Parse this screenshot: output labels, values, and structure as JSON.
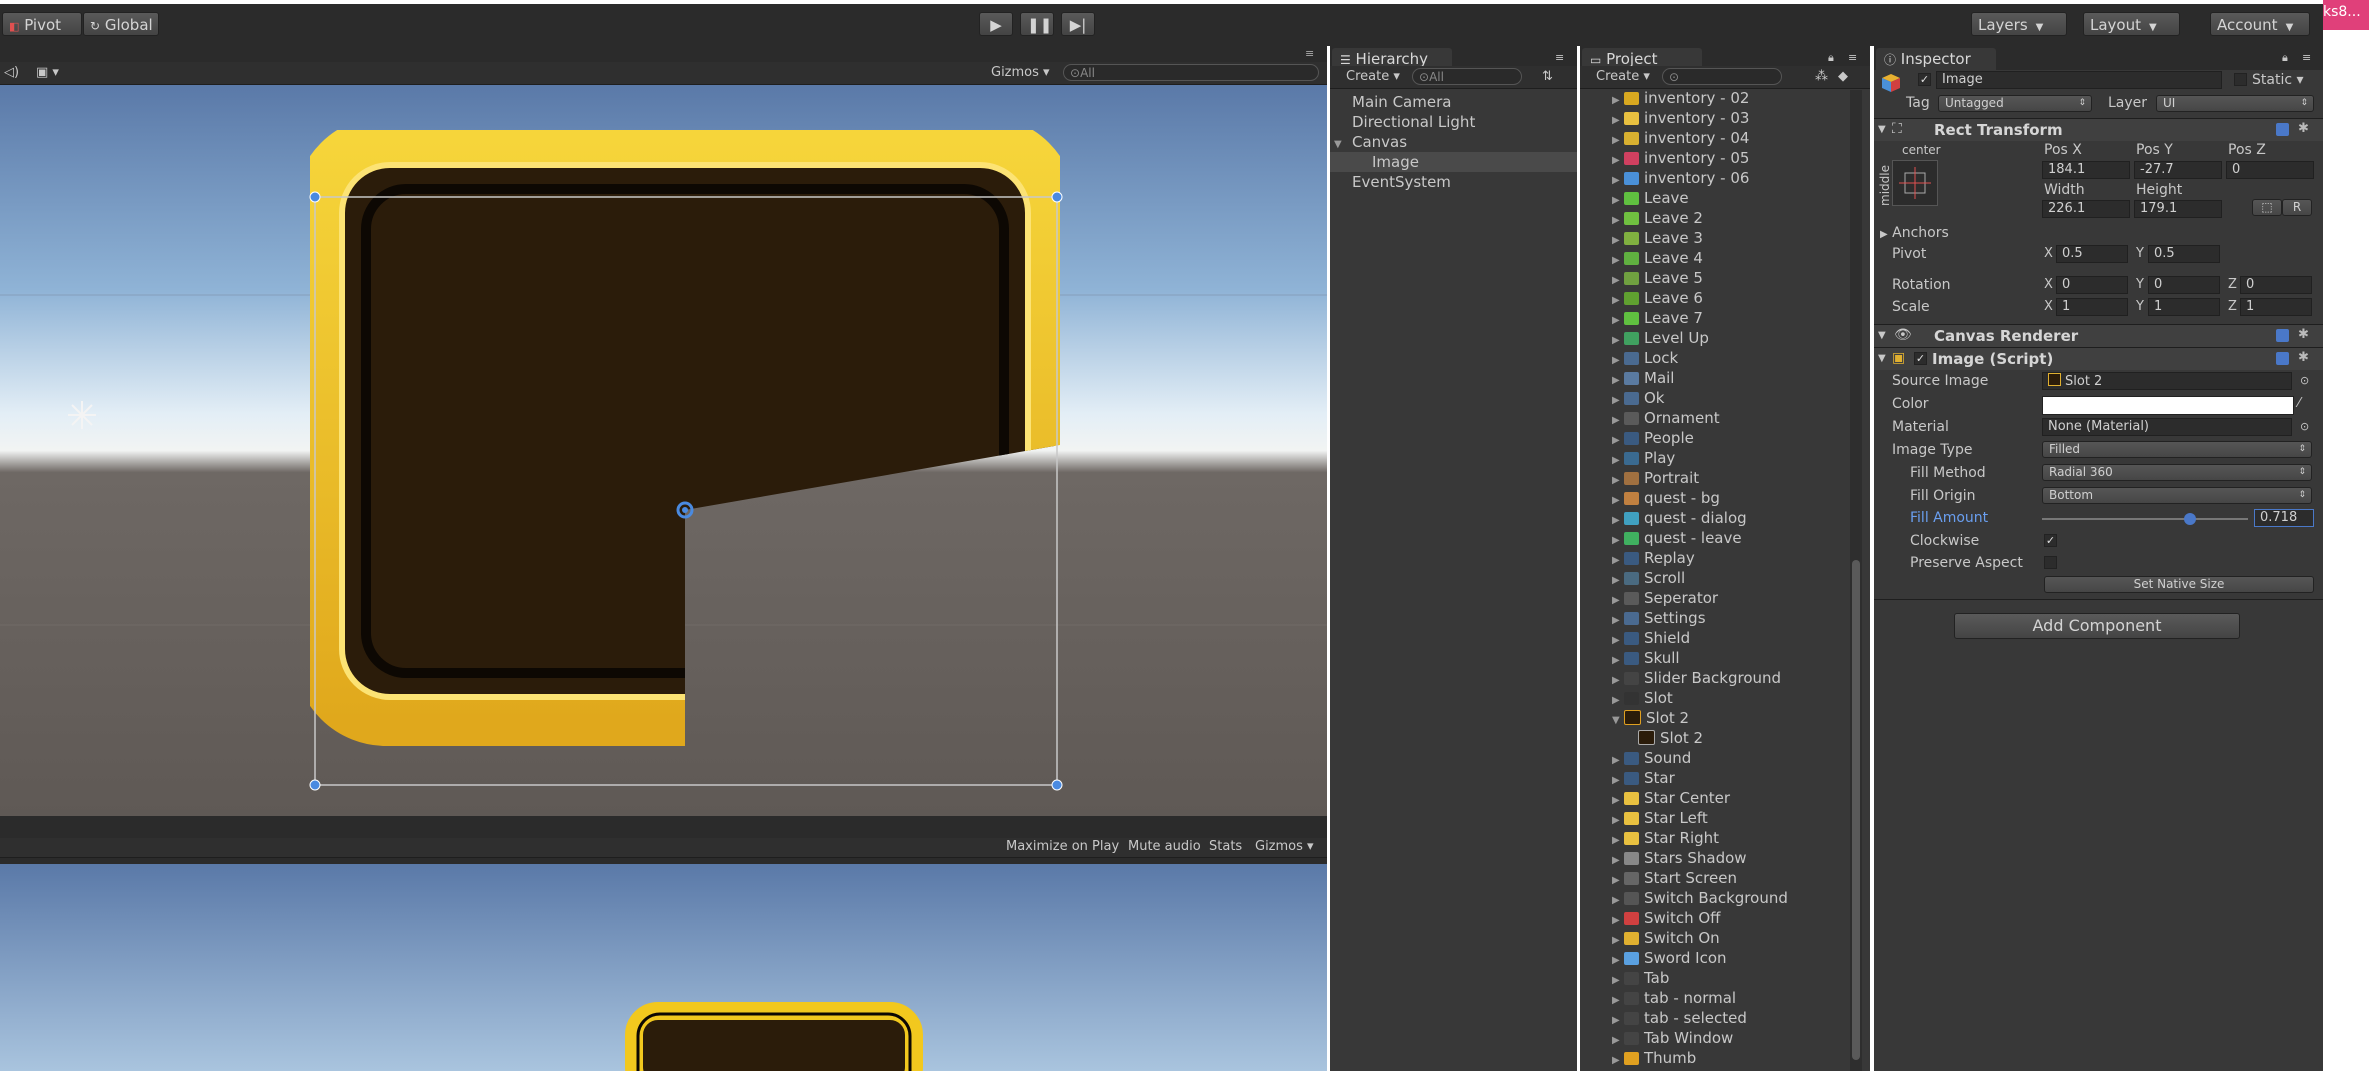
{
  "toolbar": {
    "pivot": "Pivot",
    "global": "Global",
    "layers": "Layers",
    "layout": "Layout",
    "account": "Account",
    "corner_badge": "ks8..."
  },
  "scene": {
    "gizmos": "Gizmos",
    "search_placeholder": "All"
  },
  "game": {
    "maximize": "Maximize on Play",
    "mute": "Mute audio",
    "stats": "Stats",
    "gizmos": "Gizmos"
  },
  "hierarchy": {
    "tab": "Hierarchy",
    "create": "Create",
    "search_placeholder": "All",
    "items": [
      "Main Camera",
      "Directional Light",
      "Canvas",
      "Image",
      "EventSystem"
    ]
  },
  "project": {
    "tab": "Project",
    "create": "Create",
    "items": [
      "inventory - 02",
      "inventory - 03",
      "inventory - 04",
      "inventory - 05",
      "inventory - 06",
      "Leave",
      "Leave 2",
      "Leave 3",
      "Leave 4",
      "Leave 5",
      "Leave 6",
      "Leave 7",
      "Level Up",
      "Lock",
      "Mail",
      "Ok",
      "Ornament",
      "People",
      "Play",
      "Portrait",
      "quest - bg",
      "quest - dialog",
      "quest - leave",
      "Replay",
      "Scroll",
      "Seperator",
      "Settings",
      "Shield",
      "Skull",
      "Slider Background",
      "Slot",
      "Slot 2",
      "Slot 2",
      "Sound",
      "Star",
      "Star Center",
      "Star Left",
      "Star Right",
      "Stars Shadow",
      "Start Screen",
      "Switch Background",
      "Switch Off",
      "Switch On",
      "Sword Icon",
      "Tab",
      "tab - normal",
      "tab - selected",
      "Tab Window",
      "Thumb"
    ]
  },
  "inspector": {
    "tab": "Inspector",
    "object_name": "Image",
    "static": "Static",
    "tag_label": "Tag",
    "tag_value": "Untagged",
    "layer_label": "Layer",
    "layer_value": "UI",
    "rect_transform": {
      "title": "Rect Transform",
      "anchor_h": "center",
      "anchor_v": "middle",
      "posx_label": "Pos X",
      "posy_label": "Pos Y",
      "posz_label": "Pos Z",
      "posx": "184.1",
      "posy": "-27.7",
      "posz": "0",
      "width_label": "Width",
      "height_label": "Height",
      "width": "226.1",
      "height": "179.1",
      "r_button": "R",
      "anchors": "Anchors",
      "pivot_label": "Pivot",
      "pivot_x": "0.5",
      "pivot_y": "0.5",
      "rotation_label": "Rotation",
      "rot_x": "0",
      "rot_y": "0",
      "rot_z": "0",
      "scale_label": "Scale",
      "scale_x": "1",
      "scale_y": "1",
      "scale_z": "1",
      "x": "X",
      "y": "Y",
      "z": "Z"
    },
    "canvas_renderer": "Canvas Renderer",
    "image_script": {
      "title": "Image (Script)",
      "source_image_label": "Source Image",
      "source_image": "Slot 2",
      "color_label": "Color",
      "material_label": "Material",
      "material": "None (Material)",
      "image_type_label": "Image Type",
      "image_type": "Filled",
      "fill_method_label": "Fill Method",
      "fill_method": "Radial 360",
      "fill_origin_label": "Fill Origin",
      "fill_origin": "Bottom",
      "fill_amount_label": "Fill Amount",
      "fill_amount": "0.718",
      "fill_amount_value": 0.718,
      "clockwise_label": "Clockwise",
      "clockwise": true,
      "preserve_label": "Preserve Aspect",
      "preserve": false,
      "native_size": "Set Native Size"
    },
    "add_component": "Add Component"
  },
  "colors": {
    "frame_gold": "#f0c419",
    "frame_dark": "#2a1a08",
    "selected_row": "#3e5f96",
    "accent_blue": "#4a78c8"
  }
}
